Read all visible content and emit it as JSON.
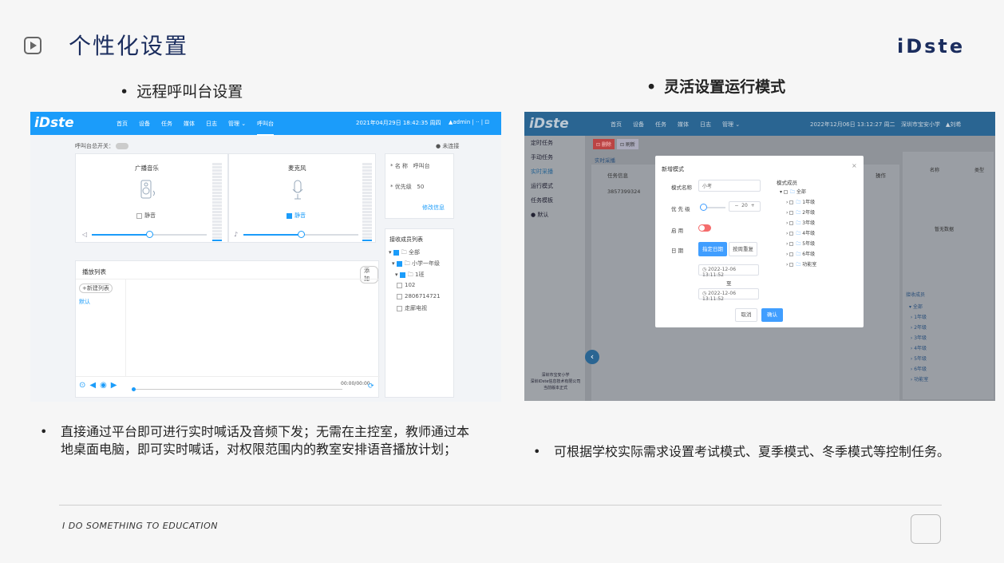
{
  "page": {
    "title": "个性化设置",
    "logo": "iDste",
    "left_heading": "远程呼叫台设置",
    "right_heading": "灵活设置运行模式",
    "left_desc": "直接通过平台即可进行实时喊话及音频下发；无需在主控室，教师通过本地桌面电脑，即可实时喊话，对权限范围内的教室安排语音播放计划；",
    "right_desc": "可根据学校实际需求设置考试模式、夏季模式、冬季模式等控制任务。",
    "footer": "I DO SOMETHING TO EDUCATION"
  },
  "left_app": {
    "brand": "iDste",
    "nav": [
      "首页",
      "设备",
      "任务",
      "媒体",
      "日志",
      "管理 ⌄",
      "呼叫台"
    ],
    "datetime": "2021年04月29日 18:42:35 周四",
    "user": "▲admin  |  ··  |  ⊡",
    "master_switch": "呼叫台总开关：",
    "status": "● 未连接",
    "broadcast_title": "广播音乐",
    "mic_title": "麦克风",
    "mute": "静音",
    "mute_checked": "静音",
    "name_label": "* 名  称",
    "name_value": "呼叫台",
    "priority_label": "* 优先级",
    "priority_value": "50",
    "edit_link": "修改信息",
    "playlist_title": "播放列表",
    "playlist_btn": "添加",
    "add_list_btn": "+新建列表",
    "default_item": "默认",
    "time_display": "00:00/00:00",
    "receivers_title": "接收成员列表",
    "tree": [
      "全部",
      "小学一年级",
      "1班",
      "102",
      "2806714721",
      "走廊电视"
    ],
    "broadcast_level": 0.2,
    "mic_level": 0.25,
    "broadcast_volume": 0.5,
    "mic_volume": 0.5
  },
  "right_app": {
    "brand": "iDste",
    "nav": [
      "首页",
      "设备",
      "任务",
      "媒体",
      "日志",
      "管理 ⌄"
    ],
    "datetime": "2022年12月06日 13:12:27 周二",
    "school": "深圳市宝安小学",
    "user": "▲刘希",
    "sidebar": [
      "定时任务",
      "手动任务",
      "实时采播",
      "运行模式",
      "任务模板",
      "● 默认"
    ],
    "toolbar": [
      "⊡ 删除",
      "⊡ 刷新"
    ],
    "tab": "实时采播",
    "col_task": "任务信息",
    "task_row": "3857399324",
    "col_op": "操作",
    "col_name": "名称",
    "col_type": "类型",
    "no_data": "暂无数据",
    "members_label": "接收成员",
    "bottom_tree": [
      "全部",
      "1年级",
      "2年级",
      "3年级",
      "4年级",
      "5年级",
      "6年级",
      "功能室"
    ],
    "sidebar_footer": [
      "深圳市宝安小学",
      "深圳iDste信息技术有限公司",
      "当前版本正式"
    ],
    "modal": {
      "title": "新增模式",
      "close": "×",
      "mode_name_label": "模式名称",
      "mode_name_value": "小考",
      "priority_label": "优 先 级",
      "priority_value": "20",
      "enable_label": "启    用",
      "date_label": "日    期",
      "tab_active": "指定日期",
      "tab_other": "按周重复",
      "date_from": "◷ 2022-12-06 13:11:52",
      "date_to_label": "至",
      "date_to": "◷ 2022-12-06 13:11:52",
      "cancel": "取消",
      "confirm": "确认",
      "members_label": "模式成员",
      "tree": [
        "全部",
        "1年级",
        "2年级",
        "3年级",
        "4年级",
        "5年级",
        "6年级",
        "功能室"
      ]
    }
  },
  "colors": {
    "title": "#1b2d5e",
    "left_topbar": "#1b9cfa",
    "right_topbar": "#2a6592",
    "accent": "#409eff"
  }
}
